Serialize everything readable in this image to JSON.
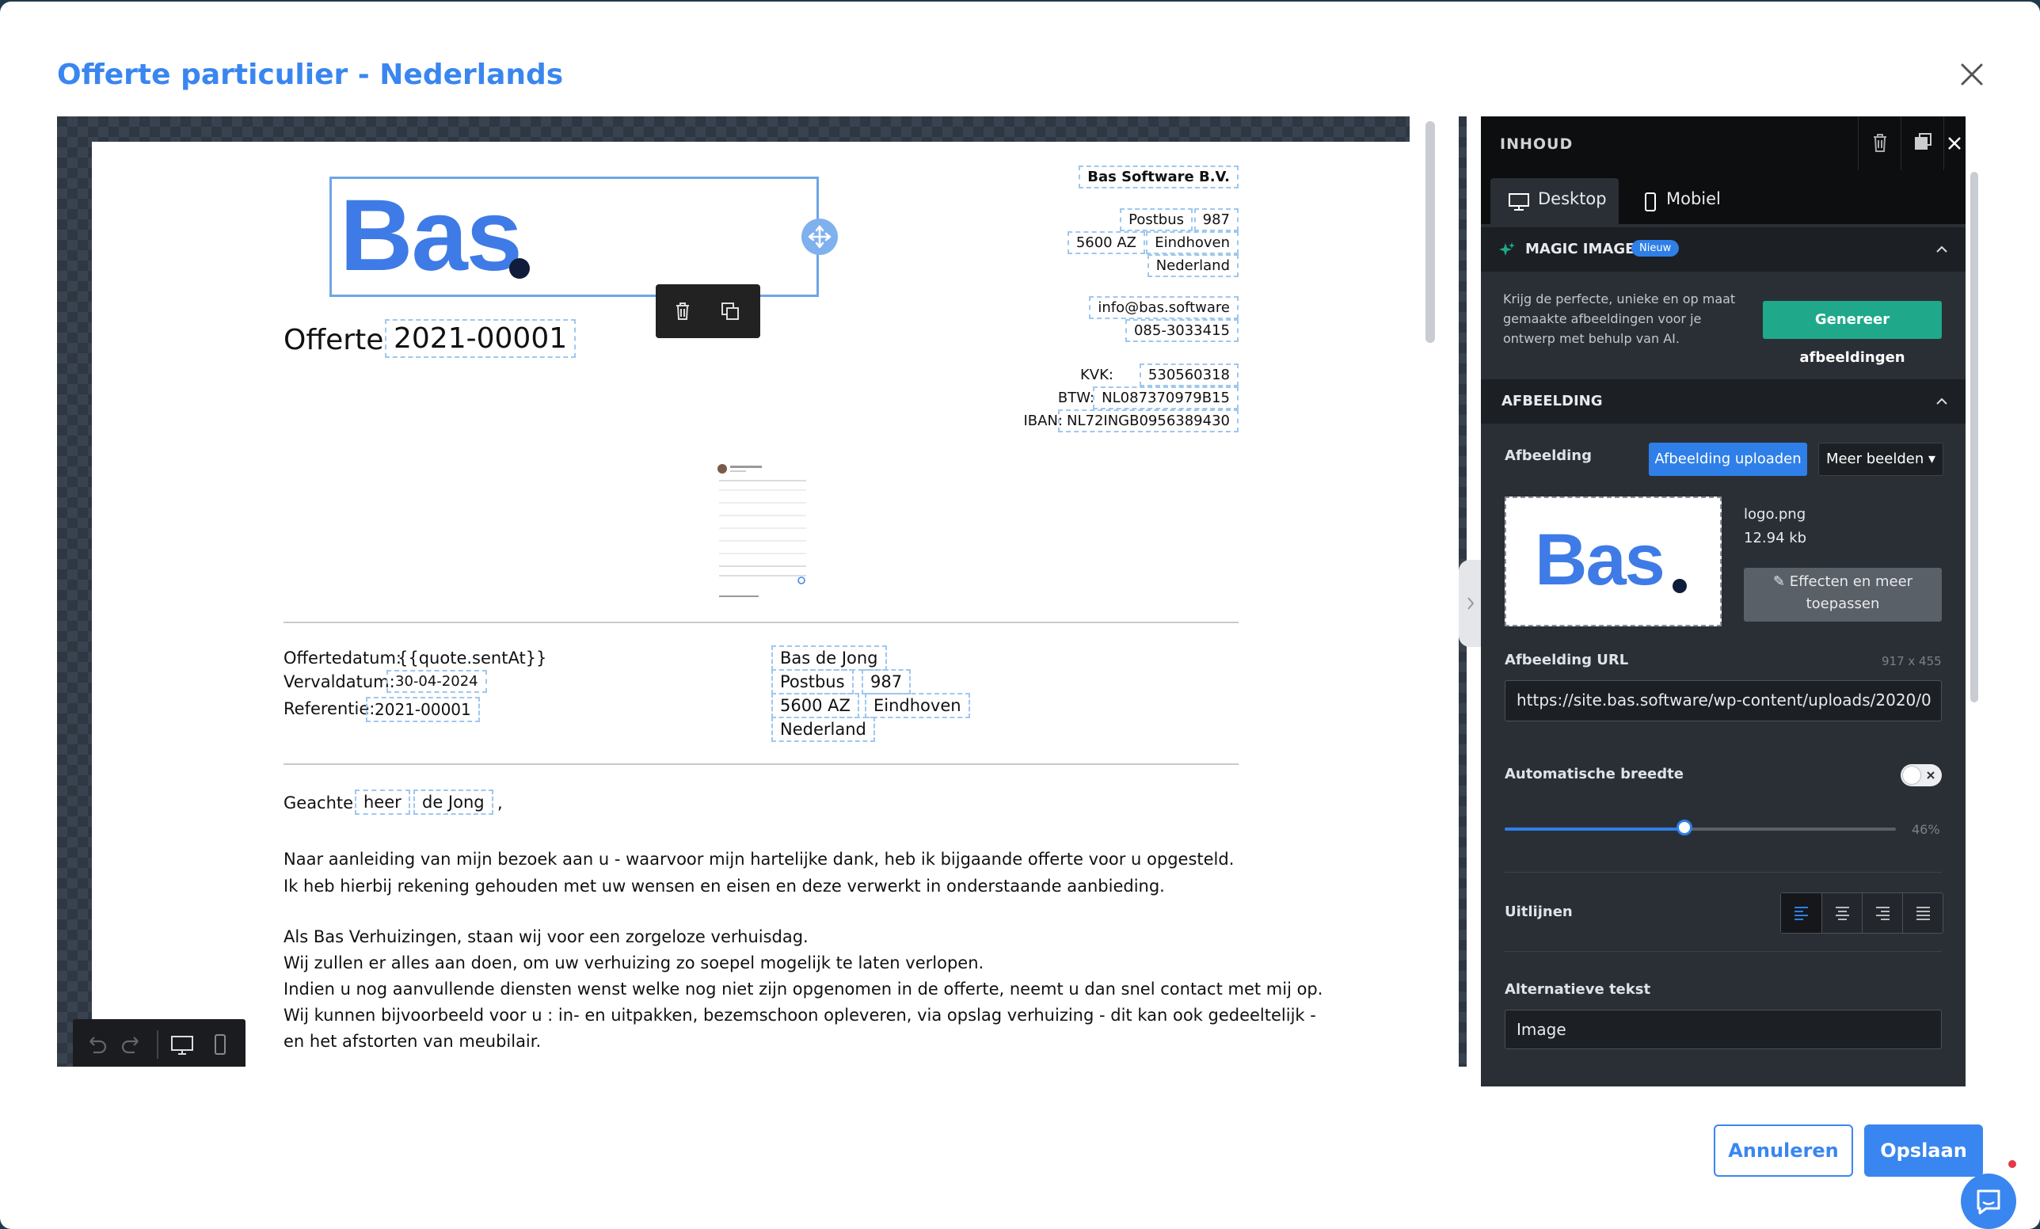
{
  "modal": {
    "title": "Offerte particulier - Nederlands"
  },
  "document": {
    "logo_text": "Bas",
    "company": {
      "name": "Bas Software B.V.",
      "street": "Postbus",
      "number": "987",
      "zip": "5600 AZ",
      "city": "Eindhoven",
      "country": "Nederland",
      "email": "info@bas.software",
      "phone": "085-3033415",
      "kvk_label": "KVK:",
      "kvk": "530560318",
      "btw_label": "BTW:",
      "btw": "NL087370979B15",
      "iban_label": "IBAN:",
      "iban": "NL72INGB0956389430"
    },
    "quote_label": "Offerte",
    "quote_number": "2021-00001",
    "quote_date_label": "Offertedatum:",
    "quote_date": "{{quote.sentAt}}",
    "expiry_label": "Vervaldatum:",
    "expiry_date": "30-04-2024",
    "reference_label": "Referentie:",
    "reference": "2021-00001",
    "customer": {
      "name": "Bas de Jong",
      "street": "Postbus",
      "number": "987",
      "zip": "5600 AZ",
      "city": "Eindhoven",
      "country": "Nederland"
    },
    "salutation": "Geachte",
    "title": "heer",
    "lastname": "de Jong",
    "comma": ",",
    "paragraph1": [
      "Naar aanleiding van mijn bezoek aan u - waarvoor mijn hartelijke dank, heb ik bijgaande offerte voor u opgesteld.",
      "Ik heb hierbij rekening gehouden met uw wensen en eisen en deze verwerkt in onderstaande aanbieding."
    ],
    "paragraph2": [
      "Als Bas Verhuizingen, staan wij voor een zorgeloze verhuisdag.",
      "Wij zullen er alles aan doen, om uw verhuizing zo soepel mogelijk te laten verlopen.",
      "Indien u nog aanvullende diensten wenst welke nog niet zijn opgenomen in de offerte, neemt u dan snel contact met mij op.",
      "Wij kunnen bijvoorbeeld voor u : in- en uitpakken, bezemschoon opleveren, via opslag verhuizing - dit kan ook gedeeltelijk -",
      "en het afstorten van meubilair."
    ]
  },
  "panel": {
    "header": "INHOUD",
    "tabs": [
      "Desktop",
      "Mobiel"
    ],
    "magic": {
      "title": "MAGIC IMAGE",
      "badge": "Nieuw",
      "description": [
        "Krijg de perfecte, unieke en op maat",
        "gemaakte afbeeldingen voor je",
        "ontwerp met behulp van AI."
      ],
      "button": "Genereer afbeeldingen"
    },
    "image": {
      "section_title": "AFBEELDING",
      "label": "Afbeelding",
      "upload_button": "Afbeelding uploaden",
      "more_button": "Meer beelden",
      "thumb_text": "Bas",
      "filename": "logo.png",
      "filesize": "12.94 kb",
      "effects_button": [
        "Effecten en meer",
        "toepassen"
      ],
      "url_label": "Afbeelding URL",
      "dimensions": "917 x 455",
      "url_value": "https://site.bas.software/wp-content/uploads/2020/0",
      "auto_width_label": "Automatische breedte",
      "width_percent": 46,
      "width_display": "46%",
      "align_label": "Uitlijnen",
      "alt_label": "Alternatieve tekst",
      "alt_value": "Image"
    }
  },
  "footer": {
    "cancel": "Annuleren",
    "save": "Opslaan"
  },
  "colors": {
    "accent": "#3a86f0",
    "panel_bg": "#2a2f36",
    "green": "#1fa98a"
  }
}
